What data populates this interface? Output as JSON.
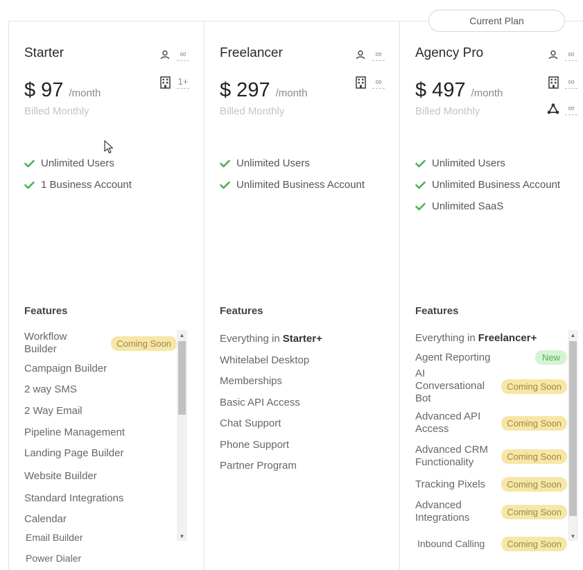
{
  "current_plan_label": "Current Plan",
  "plans": [
    {
      "name": "Starter",
      "price": "$ 97",
      "period": "/month",
      "billing": "Billed Monthly",
      "users_limit": "∞",
      "accounts_limit": "1+",
      "checks": [
        "Unlimited Users",
        "1 Business Account"
      ],
      "features_title": "Features",
      "features": [
        {
          "label": "Workflow Builder",
          "badge": "Coming Soon"
        },
        {
          "label": "Campaign Builder"
        },
        {
          "label": "2 way SMS"
        },
        {
          "label": "2 Way Email"
        },
        {
          "label": "Pipeline Management"
        },
        {
          "label": "Landing Page Builder"
        },
        {
          "label": "Website Builder"
        },
        {
          "label": "Standard Integrations"
        },
        {
          "label": "Calendar"
        },
        {
          "label": "Email Builder"
        },
        {
          "label": "Power Dialer"
        }
      ]
    },
    {
      "name": "Freelancer",
      "price": "$ 297",
      "period": "/month",
      "billing": "Billed Monthly",
      "users_limit": "∞",
      "accounts_limit": "∞",
      "checks": [
        "Unlimited Users",
        "Unlimited Business Account"
      ],
      "features_title": "Features",
      "features_intro": "Everything in",
      "features_intro_bold": "Starter+",
      "features": [
        {
          "label": "Whitelabel Desktop"
        },
        {
          "label": "Memberships"
        },
        {
          "label": "Basic API Access"
        },
        {
          "label": "Chat Support"
        },
        {
          "label": "Phone Support"
        },
        {
          "label": "Partner Program"
        }
      ]
    },
    {
      "name": "Agency Pro",
      "price": "$ 497",
      "period": "/month",
      "billing": "Billed Monthly",
      "users_limit": "∞",
      "accounts_limit": "∞",
      "saas_limit": "∞",
      "checks": [
        "Unlimited Users",
        "Unlimited Business Account",
        "Unlimited SaaS"
      ],
      "features_title": "Features",
      "features_intro": "Everything in",
      "features_intro_bold": "Freelancer+",
      "features": [
        {
          "label": "Agent Reporting",
          "badge": "New"
        },
        {
          "label": "AI Conversational Bot",
          "badge": "Coming Soon"
        },
        {
          "label": "Advanced API Access",
          "badge": "Coming Soon"
        },
        {
          "label": "Advanced CRM Functionality",
          "badge": "Coming Soon"
        },
        {
          "label": "Tracking Pixels",
          "badge": "Coming Soon"
        },
        {
          "label": "Advanced Integrations",
          "badge": "Coming Soon"
        },
        {
          "label": "Inbound Calling",
          "badge": "Coming Soon"
        }
      ]
    }
  ],
  "colors": {
    "check": "#4caf50",
    "coming_soon_bg": "#f7e6a6",
    "new_bg": "#d6f3d6",
    "border": "#e2e2e2"
  },
  "icons": [
    "user-icon",
    "building-icon",
    "network-icon",
    "check-icon",
    "cursor-icon",
    "scroll-up-icon",
    "scroll-down-icon"
  ]
}
